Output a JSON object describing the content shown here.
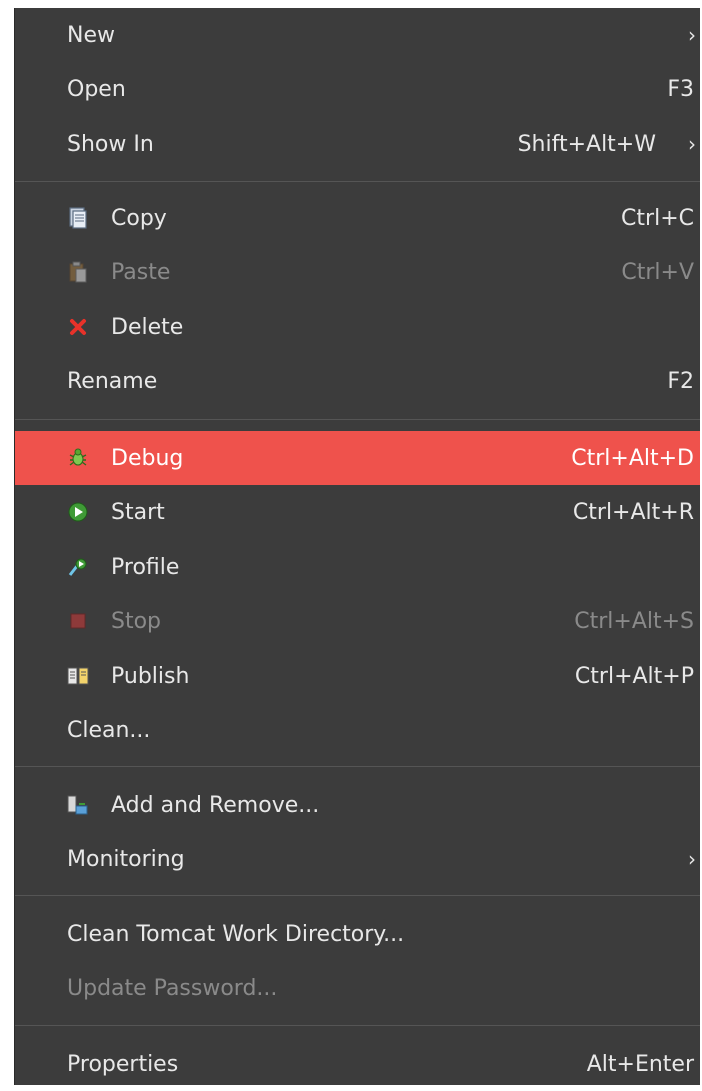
{
  "menu": {
    "items": [
      {
        "label": "New",
        "shortcut": "",
        "arrow": "›"
      },
      {
        "label": "Open",
        "shortcut": "F3"
      },
      {
        "label": "Show In",
        "shortcut": "Shift+Alt+W",
        "arrow": "›"
      },
      {
        "label": "Copy",
        "shortcut": "Ctrl+C",
        "icon": "copy-icon"
      },
      {
        "label": "Paste",
        "shortcut": "Ctrl+V",
        "icon": "paste-icon",
        "disabled": true
      },
      {
        "label": "Delete",
        "shortcut": "",
        "icon": "delete-icon"
      },
      {
        "label": "Rename",
        "shortcut": "F2"
      },
      {
        "label": "Debug",
        "shortcut": "Ctrl+Alt+D",
        "icon": "debug-icon",
        "highlighted": true
      },
      {
        "label": "Start",
        "shortcut": "Ctrl+Alt+R",
        "icon": "start-icon"
      },
      {
        "label": "Profile",
        "shortcut": "",
        "icon": "profile-icon"
      },
      {
        "label": "Stop",
        "shortcut": "Ctrl+Alt+S",
        "icon": "stop-icon",
        "disabled": true
      },
      {
        "label": "Publish",
        "shortcut": "Ctrl+Alt+P",
        "icon": "publish-icon"
      },
      {
        "label": "Clean...",
        "shortcut": ""
      },
      {
        "label": "Add and Remove...",
        "shortcut": "",
        "icon": "add-remove-icon"
      },
      {
        "label": "Monitoring",
        "shortcut": "",
        "arrow": "›"
      },
      {
        "label": "Clean Tomcat Work Directory...",
        "shortcut": ""
      },
      {
        "label": "Update Password...",
        "shortcut": "",
        "disabled": true
      },
      {
        "label": "Properties",
        "shortcut": "Alt+Enter"
      }
    ]
  },
  "colors": {
    "menu_background": "#3c3c3c",
    "highlight": "#ef524c",
    "text": "#e8e8e8",
    "disabled_text": "#8a8a8a"
  }
}
